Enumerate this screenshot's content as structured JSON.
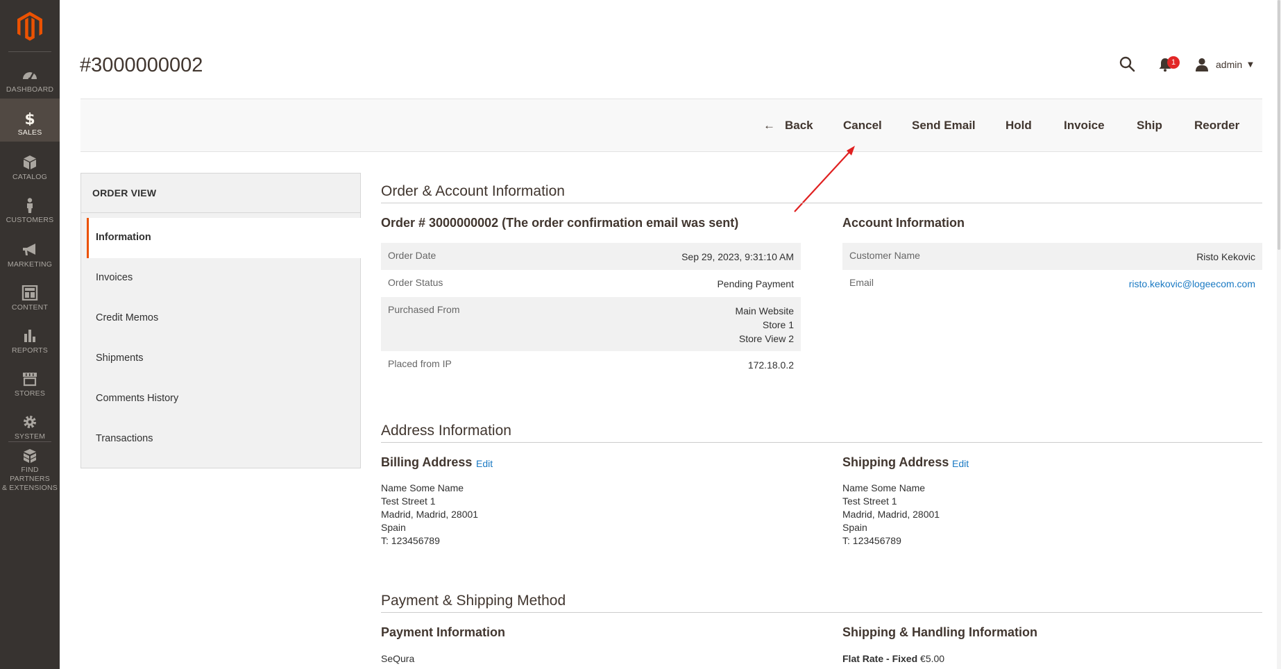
{
  "admin_menu": {
    "items": [
      {
        "label": "DASHBOARD",
        "icon": "dashboard-icon"
      },
      {
        "label": "SALES",
        "icon": "dollar-icon"
      },
      {
        "label": "CATALOG",
        "icon": "box-icon"
      },
      {
        "label": "CUSTOMERS",
        "icon": "person-icon"
      },
      {
        "label": "MARKETING",
        "icon": "megaphone-icon"
      },
      {
        "label": "CONTENT",
        "icon": "layout-icon"
      },
      {
        "label": "REPORTS",
        "icon": "bar-chart-icon"
      },
      {
        "label": "STORES",
        "icon": "storefront-icon"
      },
      {
        "label": "SYSTEM",
        "icon": "gear-icon"
      },
      {
        "label_line1": "FIND PARTNERS",
        "label_line2": "& EXTENSIONS",
        "icon": "blocks-icon"
      }
    ],
    "active": "SALES"
  },
  "header": {
    "title": "#3000000002",
    "notifications_count": "1",
    "user": "admin"
  },
  "actions": {
    "back": "Back",
    "cancel": "Cancel",
    "send_email": "Send Email",
    "hold": "Hold",
    "invoice": "Invoice",
    "ship": "Ship",
    "reorder": "Reorder"
  },
  "order_view": {
    "title": "ORDER VIEW",
    "tabs": [
      "Information",
      "Invoices",
      "Credit Memos",
      "Shipments",
      "Comments History",
      "Transactions"
    ],
    "active_tab": "Information"
  },
  "order_account": {
    "section_title": "Order & Account Information",
    "order_title": "Order # 3000000002 (The order confirmation email was sent)",
    "order_rows": [
      {
        "label": "Order Date",
        "value": "Sep 29, 2023, 9:31:10 AM"
      },
      {
        "label": "Order Status",
        "value": "Pending Payment"
      },
      {
        "label": "Purchased From",
        "value_lines": [
          "Main Website",
          "Store 1",
          "Store View 2"
        ]
      },
      {
        "label": "Placed from IP",
        "value": "172.18.0.2"
      }
    ],
    "account_title": "Account Information",
    "account_rows": [
      {
        "label": "Customer Name",
        "value": "Risto Kekovic"
      },
      {
        "label": "Email",
        "value": "risto.kekovic@logeecom.com"
      }
    ]
  },
  "address_info": {
    "section_title": "Address Information",
    "billing": {
      "title": "Billing Address",
      "edit": "Edit",
      "lines": [
        "Name Some Name",
        "Test Street 1",
        "Madrid, Madrid, 28001",
        "Spain",
        "T: 123456789"
      ]
    },
    "shipping": {
      "title": "Shipping Address",
      "edit": "Edit",
      "lines": [
        "Name Some Name",
        "Test Street 1",
        "Madrid, Madrid, 28001",
        "Spain",
        "T: 123456789"
      ]
    }
  },
  "payment_shipping": {
    "section_title": "Payment & Shipping Method",
    "payment_title": "Payment Information",
    "payment_method": "SeQura",
    "shipping_title": "Shipping & Handling Information",
    "shipping_method": "Flat Rate - Fixed",
    "shipping_price": "€5.00"
  },
  "colors": {
    "menu_bg": "#373330",
    "menu_active": "#514943",
    "accent": "#eb5202",
    "link": "#1979c3",
    "annotation": "#e02020"
  }
}
